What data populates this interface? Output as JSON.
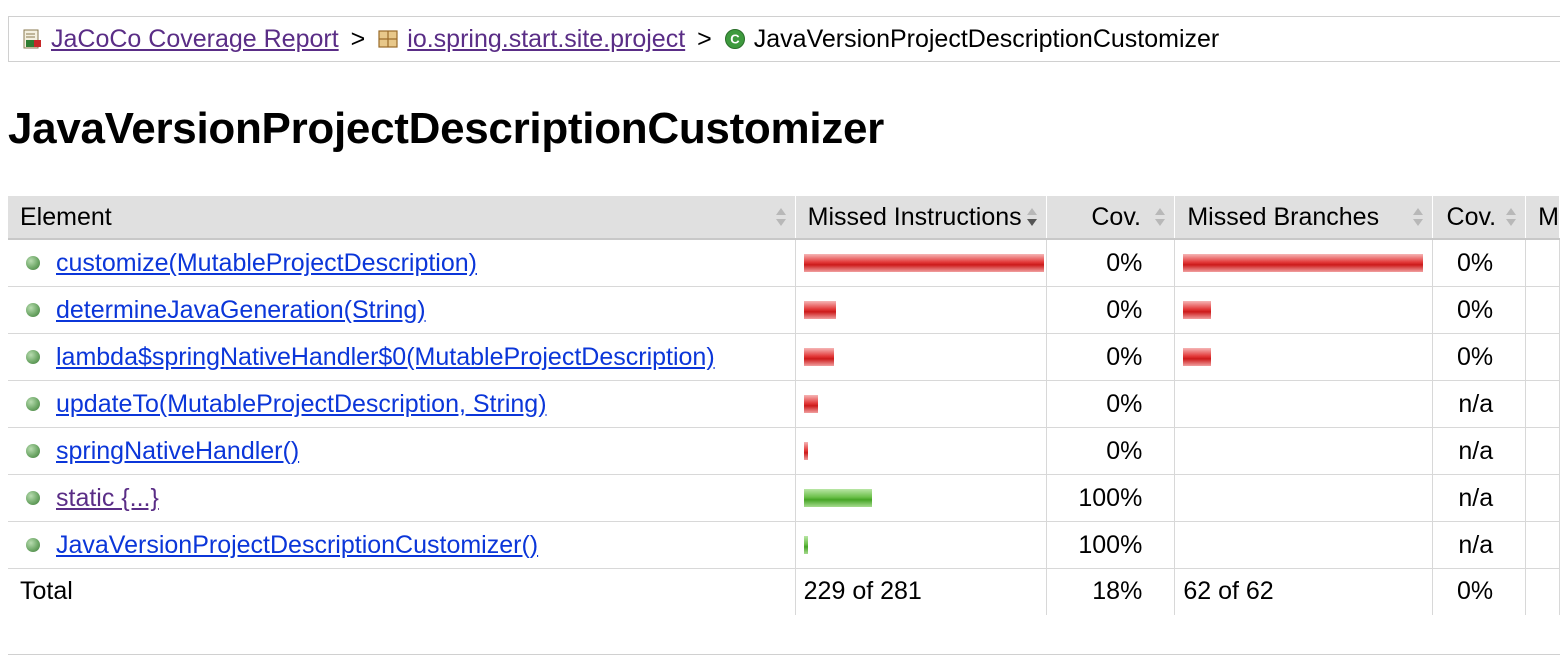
{
  "breadcrumb": {
    "root_label": "JaCoCo Coverage Report",
    "package_label": "io.spring.start.site.project",
    "current_label": "JavaVersionProjectDescriptionCustomizer",
    "separator": ">"
  },
  "page_title": "JavaVersionProjectDescriptionCustomizer",
  "table": {
    "columns": [
      "Element",
      "Missed Instructions",
      "Cov.",
      "Missed Branches",
      "Cov.",
      "M"
    ],
    "rows": [
      {
        "element": "customize(MutableProjectDescription)",
        "instr_missed_ratio": 1.0,
        "instr_covered_ratio": 0,
        "instr_cov": "0%",
        "branch_missed_ratio": 1.0,
        "branch_cov": "0%",
        "visited": false
      },
      {
        "element": "determineJavaGeneration(String)",
        "instr_missed_ratio": 0.133,
        "instr_covered_ratio": 0,
        "instr_cov": "0%",
        "branch_missed_ratio": 0.117,
        "branch_cov": "0%",
        "visited": false
      },
      {
        "element": "lambda$springNativeHandler$0(MutableProjectDescription)",
        "instr_missed_ratio": 0.125,
        "instr_covered_ratio": 0,
        "instr_cov": "0%",
        "branch_missed_ratio": 0.117,
        "branch_cov": "0%",
        "visited": false
      },
      {
        "element": "updateTo(MutableProjectDescription, String)",
        "instr_missed_ratio": 0.058,
        "instr_covered_ratio": 0,
        "instr_cov": "0%",
        "branch_missed_ratio": 0,
        "branch_cov": "n/a",
        "visited": false
      },
      {
        "element": "springNativeHandler()",
        "instr_missed_ratio": 0.017,
        "instr_covered_ratio": 0,
        "instr_cov": "0%",
        "branch_missed_ratio": 0,
        "branch_cov": "n/a",
        "visited": false
      },
      {
        "element": "static {...}",
        "instr_missed_ratio": 0,
        "instr_covered_ratio": 0.283,
        "instr_cov": "100%",
        "branch_missed_ratio": 0,
        "branch_cov": "n/a",
        "visited": true
      },
      {
        "element": "JavaVersionProjectDescriptionCustomizer()",
        "instr_missed_ratio": 0,
        "instr_covered_ratio": 0.017,
        "instr_cov": "100%",
        "branch_missed_ratio": 0,
        "branch_cov": "n/a",
        "visited": false
      }
    ],
    "total": {
      "label": "Total",
      "instructions": "229 of 281",
      "instr_cov": "18%",
      "branches": "62 of 62",
      "branch_cov": "0%"
    }
  },
  "colors": {
    "missed": "#e33a3a",
    "covered": "#6cc04a",
    "link": "#0b36d9",
    "visited_link": "#5a2d86",
    "header_bg": "#e0e0e0"
  },
  "icons": {
    "report": "report-icon",
    "package": "package-icon",
    "class": "class-icon",
    "method": "method-dot-icon"
  }
}
